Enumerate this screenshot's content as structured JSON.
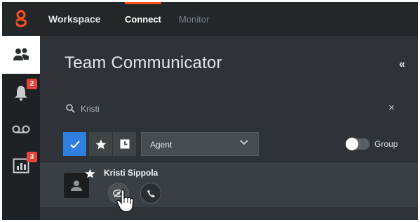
{
  "topbar": {
    "logo_icon": "genesys-logo-icon",
    "nav": {
      "workspace": "Workspace",
      "connect": "Connect",
      "monitor": "Monitor"
    },
    "accent_color": "#ff4f1f"
  },
  "sidebar": {
    "items": [
      {
        "icon": "team-communicator-icon",
        "active": true
      },
      {
        "icon": "notifications-bell-icon",
        "badge": "2"
      },
      {
        "icon": "voicemail-icon"
      },
      {
        "icon": "statistics-icon",
        "badge": "3"
      }
    ]
  },
  "panel": {
    "title": "Team Communicator",
    "collapse_label": "«",
    "search": {
      "value": "Kristi",
      "clear_label": "×"
    },
    "filters": {
      "active_color": "#2f7fe0",
      "type_selected": "Agent",
      "group_label": "Group",
      "group_toggle_on": false
    },
    "results": [
      {
        "name": "Kristi Sippola",
        "favorite": true,
        "actions": [
          "consult-icon",
          "call-icon"
        ]
      }
    ]
  }
}
